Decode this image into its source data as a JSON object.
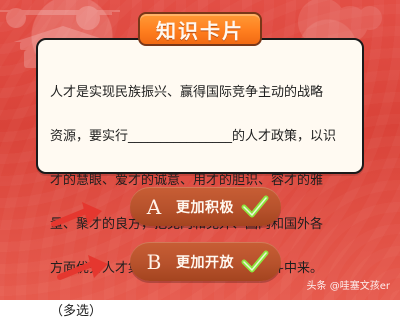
{
  "card": {
    "title": "知识卡片",
    "question_line_1": "人才是实现民族振兴、赢得国际竞争主动的战略",
    "question_line_2": "资源，要实行________________的人才政策，以识",
    "question_line_3": "才的慧眼、爱才的诚意、用才的胆识、容才的雅",
    "question_line_4": "量、聚才的良方，把党内和党外、国内和国外各",
    "question_line_5": "方面优秀人才集聚到党和人民的伟大奋斗中来。",
    "note": "（多选）"
  },
  "options": [
    {
      "letter": "A",
      "label": "更加积极"
    },
    {
      "letter": "B",
      "label": "更加开放"
    }
  ],
  "watermark": "头条 @哇塞文孩er"
}
